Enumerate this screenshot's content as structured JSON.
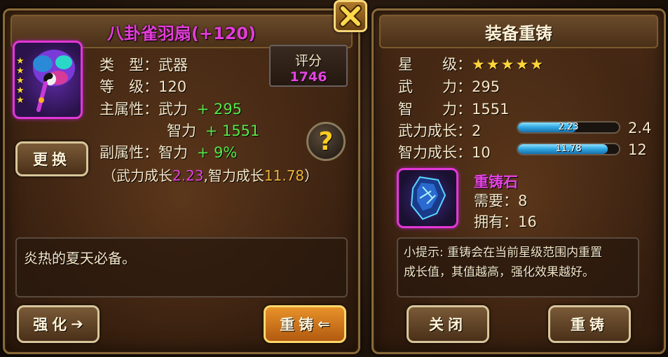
{
  "left": {
    "title": "八卦雀羽扇(+120)",
    "item": {
      "stars": 5,
      "icon": "feather-fan-icon"
    },
    "type_label": "类　型：",
    "type_value": "武器",
    "level_label": "等　级：",
    "level_value": "120",
    "main_attr_label": "主属性：",
    "main_attr_1_name": "武力",
    "main_attr_1_value": "+ 295",
    "main_attr_2_name": "智力",
    "main_attr_2_value": "+ 1551",
    "sub_attr_label": "副属性：",
    "sub_attr_name": "智力",
    "sub_attr_value": "+ 9%",
    "growth_open": "（武力成长",
    "growth_force": "2.23",
    "growth_mid": ",智力成长",
    "growth_int": "11.78",
    "growth_close": "）",
    "score_label": "评分",
    "score_value": "1746",
    "help_symbol": "?",
    "replace_button": "更换",
    "description": "炎热的夏天必备。",
    "enhance_button": "强化",
    "enhance_arrow": "➔",
    "recast_button": "重铸",
    "recast_arrow": "⇐"
  },
  "right": {
    "title": "装备重铸",
    "star_label": "星　　级：",
    "stars": "★★★★★",
    "force_label": "武　　力：",
    "force_value": "295",
    "int_label": "智　　力：",
    "int_value": "1551",
    "force_growth_label": "武力成长：",
    "force_growth_min": "2",
    "force_growth_current": "2.23",
    "force_growth_max": "2.4",
    "force_growth_fill": 0.58,
    "int_growth_label": "智力成长：",
    "int_growth_min": "10",
    "int_growth_current": "11.78",
    "int_growth_max": "12",
    "int_growth_fill": 0.89,
    "stone_name": "重铸石",
    "need_label": "需要：",
    "need_value": "8",
    "have_label": "拥有：",
    "have_value": "16",
    "tip_line1": "小提示: 重铸会在当前星级范围内重置",
    "tip_line2": "成长值，其值越高，强化效果越好。",
    "close_button": "关闭",
    "recast_button": "重铸"
  },
  "colors": {
    "magenta": "#e444e0",
    "green": "#56e84a",
    "orange": "#f0b43c",
    "bar": "#2ea6e0"
  }
}
